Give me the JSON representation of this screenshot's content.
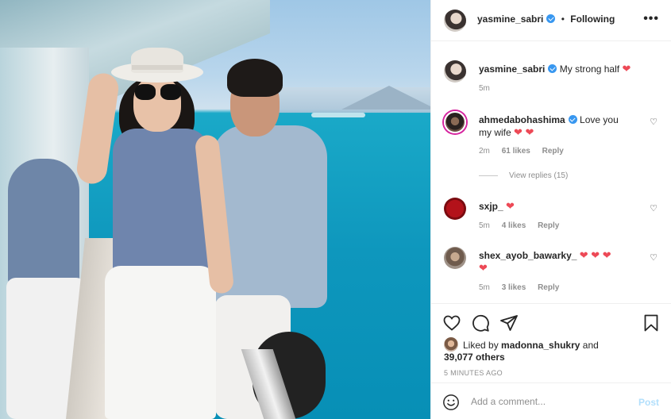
{
  "post": {
    "image_alt": "",
    "author": "yasmine_sabri",
    "follow_state": "Following",
    "separator": "•",
    "more_icon": "more-horizontal-icon"
  },
  "caption": {
    "username": "yasmine_sabri",
    "text": "My strong half",
    "emoji": "❤",
    "time": "5m"
  },
  "comments": [
    {
      "username": "ahmedabohashima",
      "verified": true,
      "text_line1": "Love you",
      "text_line2": "my wife",
      "emoji": "❤ ❤",
      "time": "2m",
      "likes": "61 likes",
      "reply": "Reply",
      "view_replies": "View replies (15)"
    },
    {
      "username": "sxjp_",
      "text": "",
      "emoji": "❤",
      "time": "5m",
      "likes": "4 likes",
      "reply": "Reply"
    },
    {
      "username": "shex_ayob_bawarky_",
      "emoji": "❤ ❤ ❤",
      "emoji_line2": "❤",
      "time": "5m",
      "likes": "3 likes",
      "reply": "Reply"
    }
  ],
  "actions": {
    "liked_by_prefix": "Liked by",
    "liked_by_user": "madonna_shukry",
    "and": "and",
    "others": "39,077 others",
    "time_ago": "5 MINUTES AGO"
  },
  "add_comment": {
    "placeholder": "Add a comment...",
    "post_label": "Post"
  },
  "colors": {
    "heart": "#ed4956",
    "verified": "#3897f0",
    "post_disabled": "#b2dffc"
  }
}
